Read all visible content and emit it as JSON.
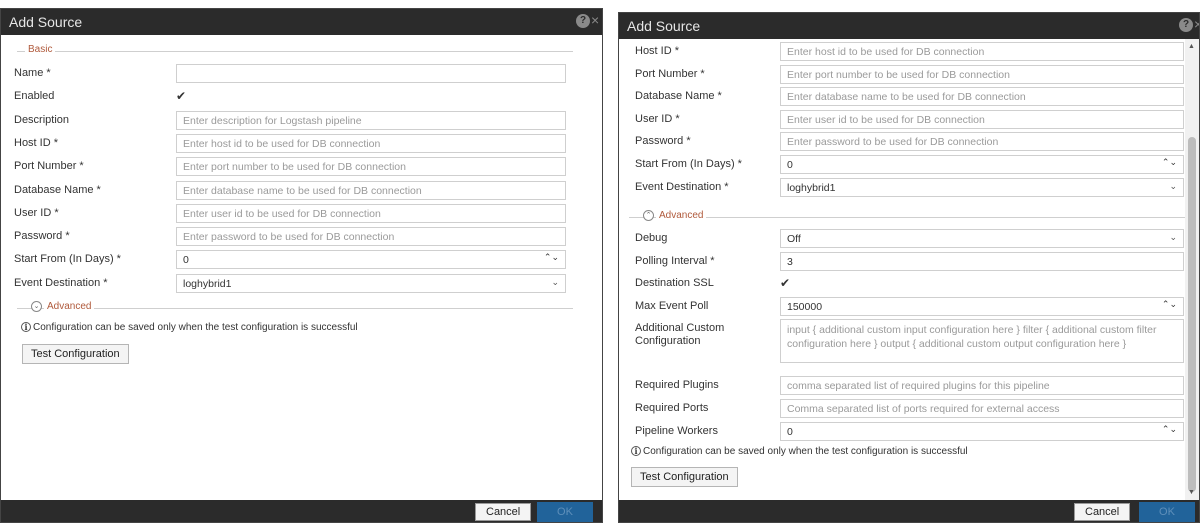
{
  "left": {
    "title": "Add Source",
    "basic_label": "Basic",
    "fields": [
      {
        "label": "Name *",
        "value": "",
        "placeholder": "",
        "kind": "text"
      },
      {
        "label": "Enabled",
        "value": "✔",
        "kind": "check"
      },
      {
        "label": "Description",
        "value": "",
        "placeholder": "Enter description for Logstash pipeline",
        "kind": "text"
      },
      {
        "label": "Host ID *",
        "value": "",
        "placeholder": "Enter host id to be used for DB connection",
        "kind": "text"
      },
      {
        "label": "Port Number *",
        "value": "",
        "placeholder": "Enter port number to be used for DB connection",
        "kind": "text"
      },
      {
        "label": "Database Name *",
        "value": "",
        "placeholder": "Enter database name to be used for DB connection",
        "kind": "text"
      },
      {
        "label": "User ID *",
        "value": "",
        "placeholder": "Enter user id to be used for DB connection",
        "kind": "text"
      },
      {
        "label": "Password *",
        "value": "",
        "placeholder": "Enter password to be used for DB connection",
        "kind": "text"
      },
      {
        "label": "Start From (In Days) *",
        "value": "0",
        "kind": "spin"
      },
      {
        "label": "Event Destination *",
        "value": "loghybrid1",
        "kind": "select"
      }
    ],
    "advanced_label": "Advanced",
    "info_text": "Configuration can be saved only when the test configuration is successful",
    "test_button": "Test Configuration",
    "cancel_button": "Cancel",
    "ok_button": "OK"
  },
  "right": {
    "title": "Add Source",
    "fields": [
      {
        "label": "Host ID *",
        "value": "",
        "placeholder": "Enter host id to be used for DB connection",
        "kind": "text"
      },
      {
        "label": "Port Number *",
        "value": "",
        "placeholder": "Enter port number to be used for DB connection",
        "kind": "text"
      },
      {
        "label": "Database Name *",
        "value": "",
        "placeholder": "Enter database name to be used for DB connection",
        "kind": "text"
      },
      {
        "label": "User ID *",
        "value": "",
        "placeholder": "Enter user id to be used for DB connection",
        "kind": "text"
      },
      {
        "label": "Password *",
        "value": "",
        "placeholder": "Enter password to be used for DB connection",
        "kind": "text"
      },
      {
        "label": "Start From (In Days) *",
        "value": "0",
        "kind": "spin"
      },
      {
        "label": "Event Destination *",
        "value": "loghybrid1",
        "kind": "select"
      }
    ],
    "advanced_label": "Advanced",
    "advanced_fields": [
      {
        "label": "Debug",
        "value": "Off",
        "kind": "select"
      },
      {
        "label": "Polling Interval *",
        "value": "3",
        "kind": "text"
      },
      {
        "label": "Destination SSL",
        "value": "✔",
        "kind": "check"
      },
      {
        "label": "Max Event Poll",
        "value": "150000",
        "kind": "spin"
      },
      {
        "label": "Additional Custom Configuration",
        "value": "",
        "placeholder": "input { additional custom input configuration here } filter { additional custom filter configuration here } output { additional custom output configuration here }",
        "kind": "textarea"
      },
      {
        "label": "Required Plugins",
        "value": "",
        "placeholder": "comma separated list of required plugins for this pipeline",
        "kind": "text"
      },
      {
        "label": "Required Ports",
        "value": "",
        "placeholder": "Comma separated list of ports required for external access",
        "kind": "text"
      },
      {
        "label": "Pipeline Workers",
        "value": "0",
        "kind": "spin"
      }
    ],
    "info_text": "Configuration can be saved only when the test configuration is successful",
    "test_button": "Test Configuration",
    "cancel_button": "Cancel",
    "ok_button": "OK"
  },
  "icons": {
    "help": "?",
    "close": "×",
    "info": "i",
    "spin": "⌃⌄",
    "caret": "⌄",
    "adv_collapsed": "⌄",
    "adv_expanded": "⌃"
  },
  "colors": {
    "titlebar": "#2b2b2b",
    "ok_button": "#21639a",
    "section_label": "#b05a3c"
  }
}
